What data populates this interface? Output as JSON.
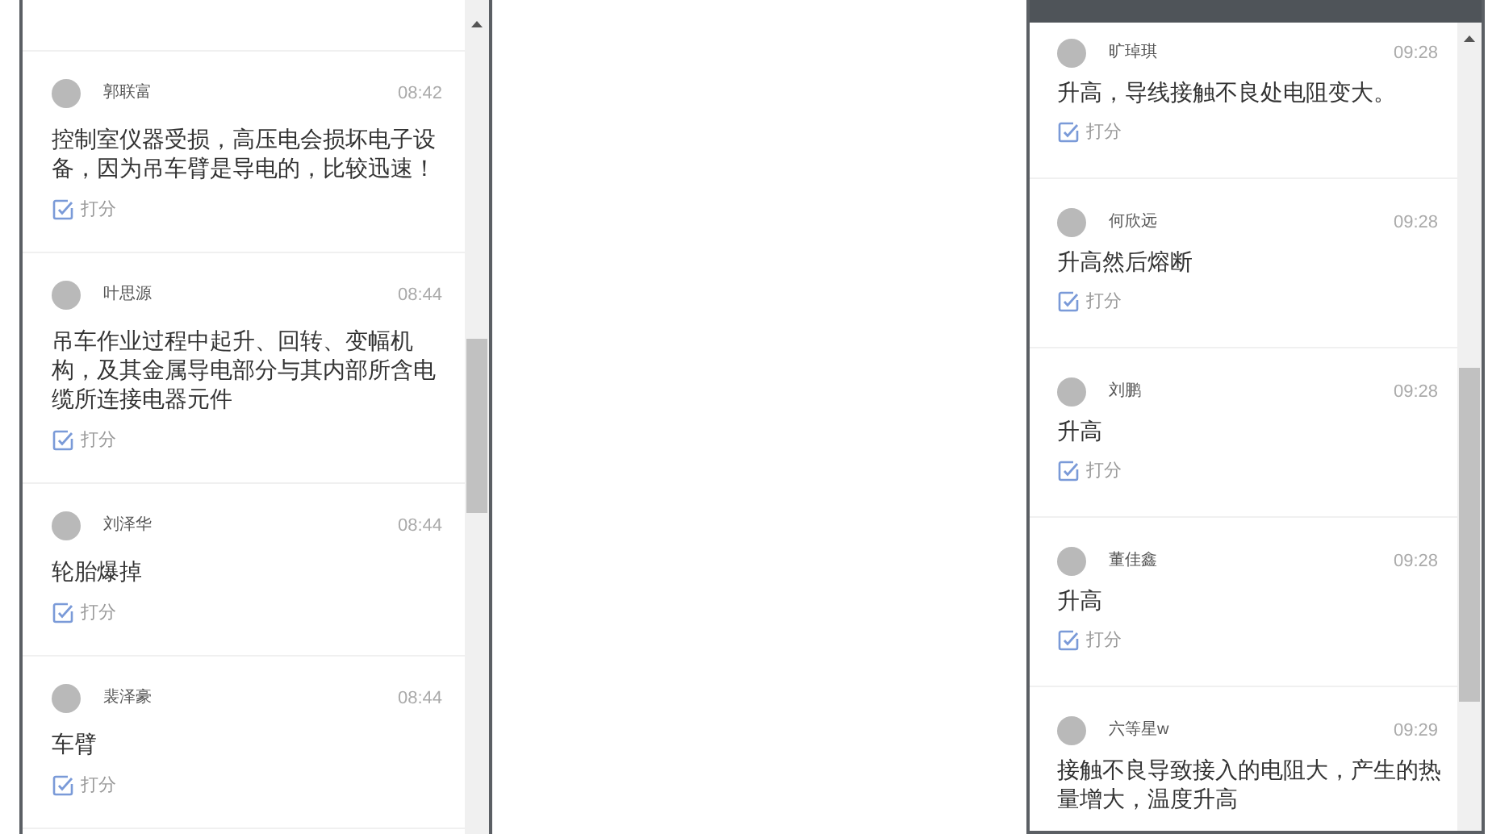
{
  "panels": [
    {
      "entries": [
        {
          "name": "郭联富",
          "time": "08:42",
          "text": "控制室仪器受损，高压电会损坏电子设备，因为吊车臂是导电的，比较迅速！",
          "action": "打分"
        },
        {
          "name": "叶思源",
          "time": "08:44",
          "text": "吊车作业过程中起升、回转、变幅机构，及其金属导电部分与其内部所含电缆所连接电器元件",
          "action": "打分"
        },
        {
          "name": "刘泽华",
          "time": "08:44",
          "text": "轮胎爆掉",
          "action": "打分"
        },
        {
          "name": "裴泽豪",
          "time": "08:44",
          "text": "车臂",
          "action": "打分"
        }
      ]
    },
    {
      "entries": [
        {
          "name": "旷琸琪",
          "time": "09:28",
          "text": "升高，导线接触不良处电阻变大。",
          "action": "打分"
        },
        {
          "name": "何欣远",
          "time": "09:28",
          "text": "升高然后熔断",
          "action": "打分"
        },
        {
          "name": "刘鹏",
          "time": "09:28",
          "text": "升高",
          "action": "打分"
        },
        {
          "name": "董佳鑫",
          "time": "09:28",
          "text": "升高",
          "action": "打分"
        },
        {
          "name": "六等星w",
          "time": "09:29",
          "text": "接触不良导致接入的电阻大，产生的热量增大，温度升高"
        }
      ]
    }
  ]
}
